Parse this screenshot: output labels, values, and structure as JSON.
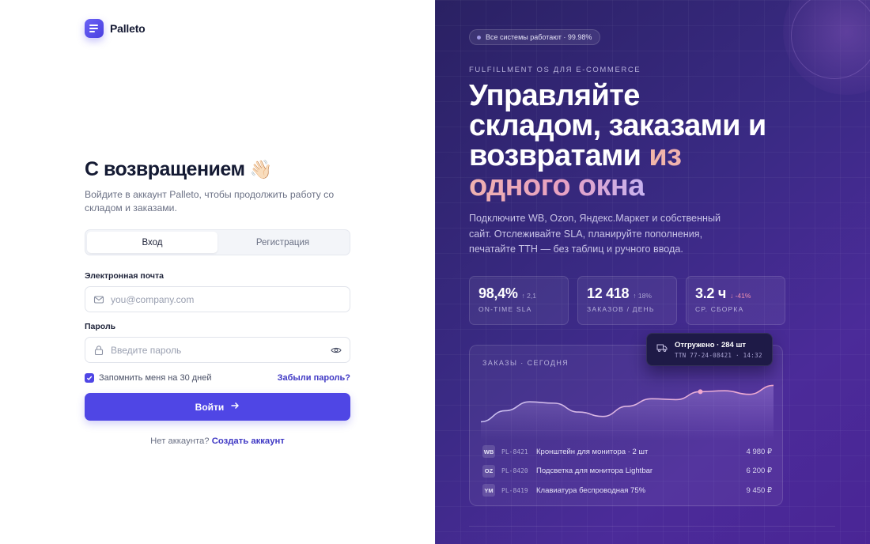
{
  "brand": {
    "name": "Palleto"
  },
  "login": {
    "title": "С возвращением",
    "wave_emoji": "👋🏻",
    "subtitle": "Войдите в аккаунт Palleto, чтобы продолжить работу со складом и заказами.",
    "tabs": [
      {
        "label": "Вход",
        "active": true
      },
      {
        "label": "Регистрация",
        "active": false
      }
    ],
    "email": {
      "label": "Электронная почта",
      "placeholder": "you@company.com",
      "value": ""
    },
    "password": {
      "label": "Пароль",
      "placeholder": "Введите пароль",
      "value": ""
    },
    "remember": {
      "label": "Запомнить меня на 30 дней",
      "checked": true
    },
    "forgot_label": "Забыли пароль?",
    "submit_label": "Войти",
    "signup_prompt": "Нет аккаунта?",
    "signup_link": "Создать аккаунт"
  },
  "hero": {
    "status": "Все системы работают · 99.98%",
    "eyebrow": "FULFILLMENT OS ДЛЯ E-COMMERCE",
    "headline_plain": "Управляйте складом, заказами и возвратами",
    "headline_accent": "из одного окна",
    "lead": "Подключите WB, Ozon, Яндекс.Маркет и собственный сайт. Отслеживайте SLA, планируйте пополнения, печатайте ТТН — без таблиц и ручного ввода.",
    "stats": [
      {
        "value": "98,4%",
        "delta": "↑ 2,1",
        "label": "ON-TIME SLA",
        "negative": false
      },
      {
        "value": "12 418",
        "delta": "↑ 18%",
        "label": "ЗАКАЗОВ / ДЕНЬ",
        "negative": false
      },
      {
        "value": "3.2 ч",
        "delta": "↓ -41%",
        "label": "СР. СБОРКА",
        "negative": true
      }
    ]
  },
  "orders_card": {
    "title": "ЗАКАЗЫ · СЕГОДНЯ",
    "trend": [
      0.1,
      0.35,
      0.55,
      0.52,
      0.32,
      0.22,
      0.45,
      0.62,
      0.6,
      0.78,
      0.8,
      0.72,
      0.92
    ],
    "orders": [
      {
        "channel": "WB",
        "code": "PL-8421",
        "name": "Кронштейн для монитора · 2 шт",
        "price": "4 980 ₽"
      },
      {
        "channel": "OZ",
        "code": "PL-8420",
        "name": "Подсветка для монитора Lightbar",
        "price": "6 200 ₽"
      },
      {
        "channel": "YM",
        "code": "PL-8419",
        "name": "Клавиатура беспроводная 75%",
        "price": "9 450 ₽"
      }
    ]
  },
  "toast": {
    "title": "Отгружено · 284 шт",
    "meta": "TTN 77-24-08421 · 14:32"
  },
  "colors": {
    "accent": "#4f46e5",
    "hero_bg": "#3a2a84"
  }
}
